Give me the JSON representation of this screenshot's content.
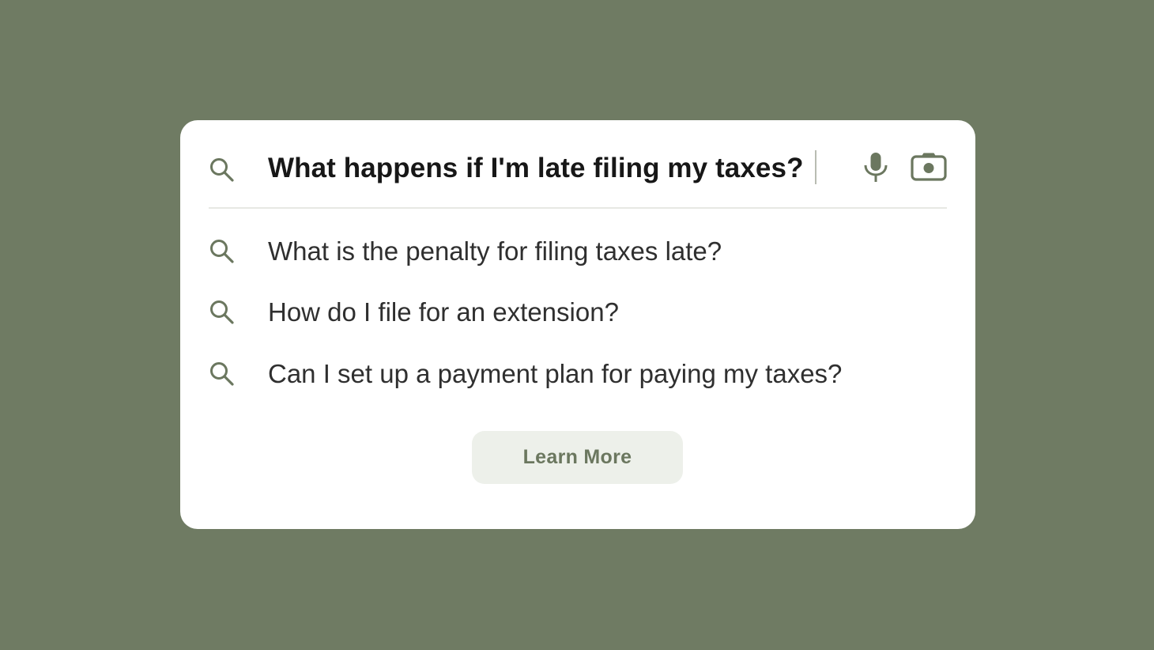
{
  "search": {
    "query": "What happens if I'm late filing my taxes?"
  },
  "suggestions": [
    {
      "text": "What is the penalty for filing taxes late?"
    },
    {
      "text": "How do I file for an extension?"
    },
    {
      "text": "Can I set up a payment plan for paying my taxes?"
    }
  ],
  "actions": {
    "learn_more_label": "Learn More"
  },
  "icons": {
    "search": "search-icon",
    "microphone": "microphone-icon",
    "camera": "camera-icon"
  },
  "colors": {
    "background": "#6f7b63",
    "card": "#ffffff",
    "accent": "#6b775f",
    "button_background": "#edf0ea"
  }
}
